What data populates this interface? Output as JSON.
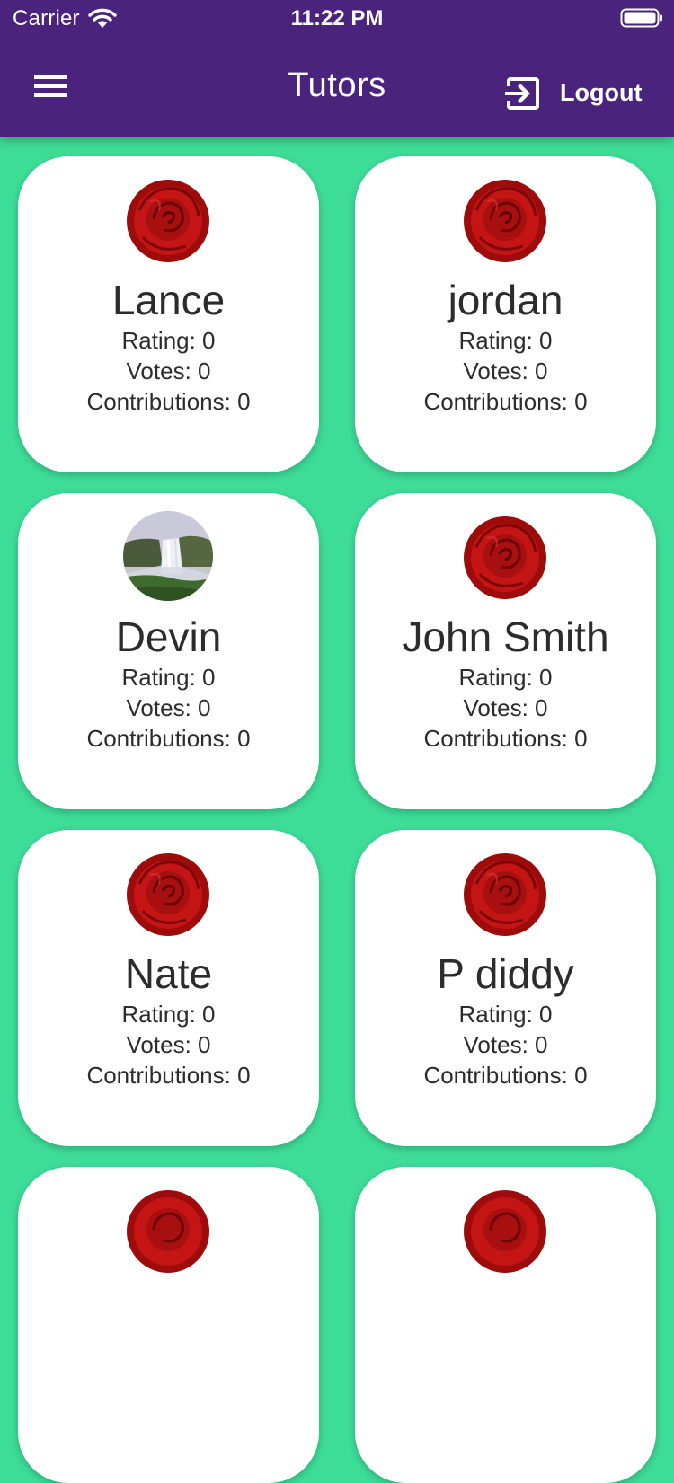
{
  "status_bar": {
    "carrier": "Carrier",
    "time": "11:22 PM"
  },
  "header": {
    "title": "Tutors",
    "logout_label": "Logout"
  },
  "tutors": [
    {
      "name": "Lance",
      "rating": "Rating: 0",
      "votes": "Votes: 0",
      "contributions": "Contributions: 0",
      "avatar": "rose"
    },
    {
      "name": "jordan",
      "rating": "Rating: 0",
      "votes": "Votes: 0",
      "contributions": "Contributions: 0",
      "avatar": "rose"
    },
    {
      "name": "Devin",
      "rating": "Rating: 0",
      "votes": "Votes: 0",
      "contributions": "Contributions: 0",
      "avatar": "waterfall"
    },
    {
      "name": "John Smith",
      "rating": "Rating: 0",
      "votes": "Votes: 0",
      "contributions": "Contributions: 0",
      "avatar": "rose"
    },
    {
      "name": "Nate",
      "rating": "Rating: 0",
      "votes": "Votes: 0",
      "contributions": "Contributions: 0",
      "avatar": "rose"
    },
    {
      "name": "P diddy",
      "rating": "Rating: 0",
      "votes": "Votes: 0",
      "contributions": "Contributions: 0",
      "avatar": "rose"
    },
    {
      "avatar": "rose"
    },
    {
      "avatar": "rose"
    }
  ],
  "colors": {
    "app_bar": "#4a247c",
    "background": "#3ddc97",
    "card": "#ffffff",
    "text": "#2c2c2c"
  }
}
